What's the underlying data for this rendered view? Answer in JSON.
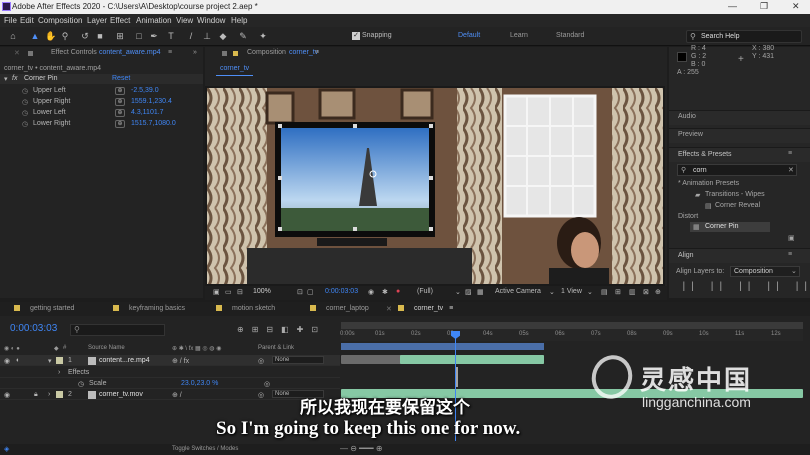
{
  "titlebar": {
    "title": "Adobe After Effects 2020 - C:\\Users\\A\\Desktop\\course project 2.aep *",
    "minimize": "—",
    "restore": "❐",
    "close": "✕"
  },
  "menu": [
    "File",
    "Edit",
    "Composition",
    "Layer",
    "Effect",
    "Animation",
    "View",
    "Window",
    "Help"
  ],
  "toolbar": {
    "snapping_label": "Snapping",
    "workspaces": [
      "Default",
      "Learn",
      "Standard"
    ],
    "active_workspace": "Default",
    "search_placeholder": "Search Help"
  },
  "effect_controls": {
    "tab_label": "Effect Controls",
    "tab_file": "content_aware.mp4",
    "breadcrumb": "corner_tv • content_aware.mp4",
    "effect_name": "Corner Pin",
    "reset_label": "Reset",
    "params": [
      {
        "label": "Upper Left",
        "value": "-2.5,39.0"
      },
      {
        "label": "Upper Right",
        "value": "1559.1,230.4"
      },
      {
        "label": "Lower Left",
        "value": "4.3,1101.7"
      },
      {
        "label": "Lower Right",
        "value": "1515.7,1080.0"
      }
    ]
  },
  "composition": {
    "tab_label": "Composition",
    "tab_name": "corner_tv",
    "sub_tab": "corner_tv",
    "zoom": "100%",
    "timecode": "0:00:03:03",
    "resolution": "(Full)",
    "camera": "Active Camera",
    "views": "1 View"
  },
  "info": {
    "r": "R : 4",
    "g": "G : 2",
    "b": "B : 0",
    "a": "A : 255",
    "x": "X : 380",
    "y": "Y : 431"
  },
  "right_panels": {
    "audio": "Audio",
    "preview": "Preview",
    "effects_presets": "Effects & Presets",
    "search_value": "corn",
    "tree": [
      "* Animation Presets",
      "Transitions - Wipes",
      "Corner Reveal",
      "Distort",
      "Corner Pin"
    ],
    "align": "Align",
    "align_layers_to": "Align Layers to:",
    "align_target": "Composition"
  },
  "timeline": {
    "tabs": [
      "getting started",
      "keyframing basics",
      "motion sketch",
      "corner_laptop",
      "corner_tv"
    ],
    "active_tab": "corner_tv",
    "timecode": "0:00:03:03",
    "ticks": [
      "0:00s",
      "01s",
      "02s",
      "03s",
      "04s",
      "05s",
      "06s",
      "07s",
      "08s",
      "09s",
      "10s",
      "11s",
      "12s"
    ],
    "source_name_header": "Source Name",
    "parent_header": "Parent & Link",
    "layers": [
      {
        "num": "1",
        "name": "content...re.mp4",
        "parent": "None"
      },
      {
        "num": "2",
        "name": "corner_tv.mov",
        "parent": "None"
      }
    ],
    "effects_label": "Effects",
    "scale_label": "Scale",
    "scale_value": "23.0,23.0 %",
    "footer": "Toggle Switches / Modes"
  },
  "subtitles": {
    "chinese": "所以我现在要保留这个",
    "english": "So I'm going to keep this one for now."
  },
  "watermark": {
    "cn": "灵感中国",
    "url": "lingganchina.com"
  },
  "colors": {
    "accent_blue": "#3f86f5",
    "timeline_bar": "#86c8a4",
    "layer_label": "#c9c9a4"
  }
}
